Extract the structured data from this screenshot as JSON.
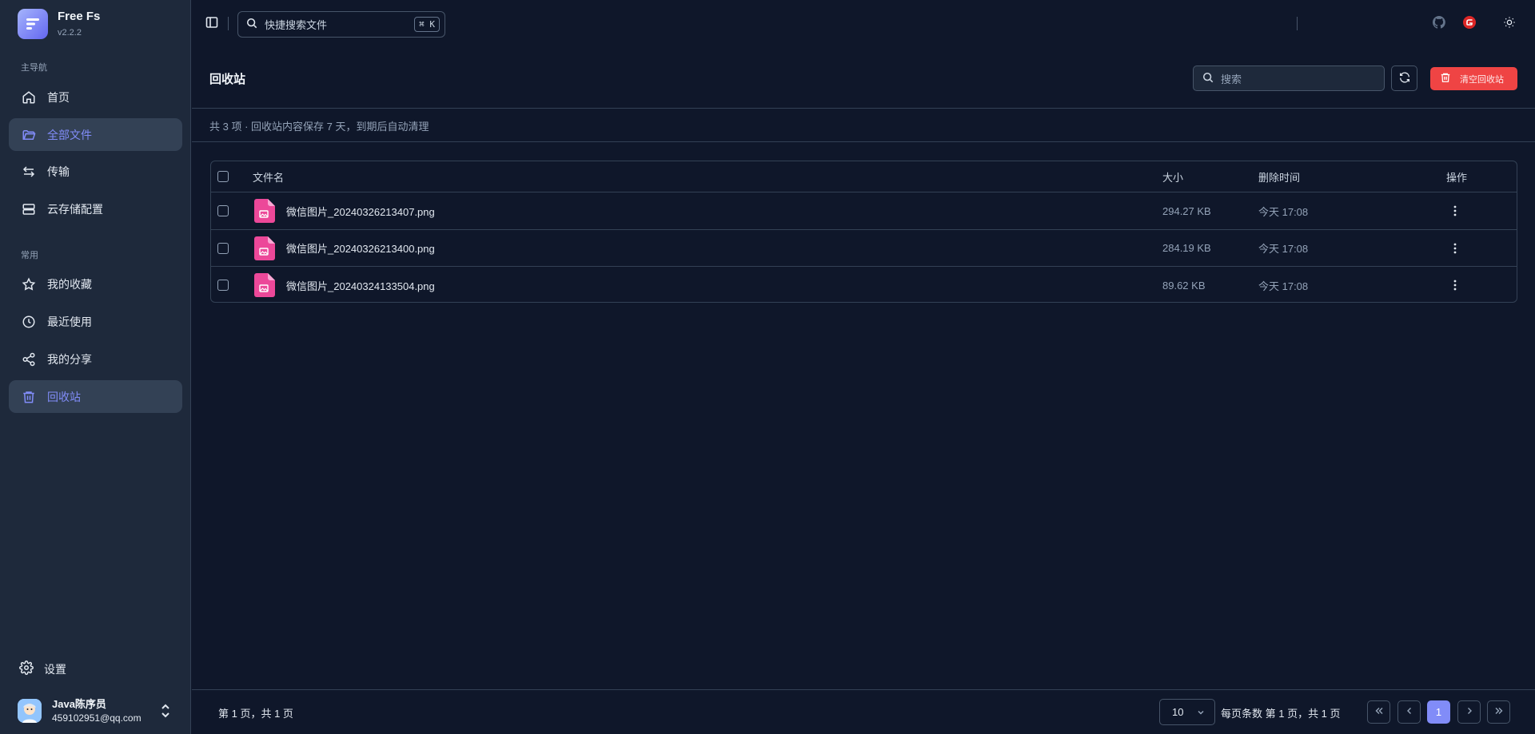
{
  "app": {
    "name": "Free Fs",
    "version": "v2.2.2"
  },
  "sidebar": {
    "main_section_label": "主导航",
    "common_section_label": "常用",
    "main_items": [
      {
        "label": "首页",
        "icon": "home-icon"
      },
      {
        "label": "全部文件",
        "icon": "folder-open-icon",
        "active": true
      },
      {
        "label": "传输",
        "icon": "transfer-icon"
      },
      {
        "label": "云存储配置",
        "icon": "server-icon"
      }
    ],
    "common_items": [
      {
        "label": "我的收藏",
        "icon": "star-icon"
      },
      {
        "label": "最近使用",
        "icon": "clock-icon"
      },
      {
        "label": "我的分享",
        "icon": "share-icon"
      },
      {
        "label": "回收站",
        "icon": "trash-icon",
        "active": true
      }
    ],
    "settings_label": "设置",
    "user": {
      "name": "Java陈序员",
      "email": "459102951@qq.com"
    }
  },
  "topbar": {
    "search_placeholder": "快捷搜索文件",
    "shortcut": "⌘ K"
  },
  "page": {
    "title": "回收站",
    "search_placeholder": "搜索",
    "empty_button_label": "清空回收站",
    "info": "共 3 项 · 回收站内容保存 7 天，到期后自动清理"
  },
  "table": {
    "headers": {
      "name": "文件名",
      "size": "大小",
      "deleted_at": "删除时间",
      "actions": "操作"
    },
    "rows": [
      {
        "name": "微信图片_20240326213407.png",
        "size": "294.27 KB",
        "deleted_at": "今天 17:08"
      },
      {
        "name": "微信图片_20240326213400.png",
        "size": "284.19 KB",
        "deleted_at": "今天 17:08"
      },
      {
        "name": "微信图片_20240324133504.png",
        "size": "89.62 KB",
        "deleted_at": "今天 17:08"
      }
    ]
  },
  "footer": {
    "page_info": "第 1 页，共 1 页",
    "page_size": "10",
    "page_size_label": "每页条数 第 1 页，共 1 页",
    "current_page": "1"
  },
  "colors": {
    "background": "#0f172a",
    "sidebar": "#1e293b",
    "accent": "#818cf8",
    "danger": "#ef4444",
    "file_icon": "#ec4899"
  }
}
